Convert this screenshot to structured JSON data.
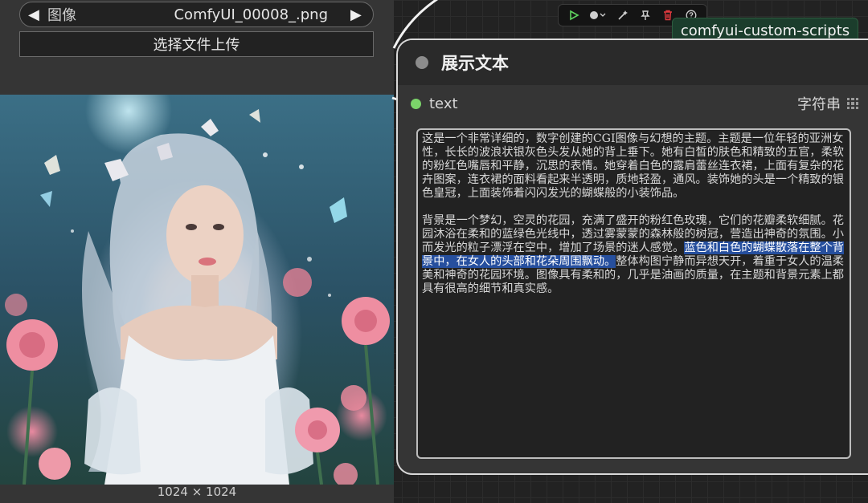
{
  "image_node": {
    "widget_label": "图像",
    "widget_value": "ComfyUI_00008_.png",
    "upload_label": "选择文件上传",
    "dimensions": "1024 × 1024"
  },
  "toolbar": {
    "icons": [
      "play-icon",
      "color-dot-icon",
      "wand-icon",
      "pin-icon",
      "trash-icon",
      "help-icon"
    ],
    "delete_color": "#e0393e",
    "play_color": "#5fd35f"
  },
  "tag": {
    "label": "comfyui-custom-scripts"
  },
  "text_node": {
    "title": "展示文本",
    "input_label": "text",
    "output_label": "字符串",
    "paragraph1": "这是一个非常详细的，数字创建的CGI图像与幻想的主题。主题是一位年轻的亚洲女性，长长的波浪状银灰色头发从她的背上垂下。她有白皙的肤色和精致的五官，柔软的粉红色嘴唇和平静，沉思的表情。她穿着白色的露肩蕾丝连衣裙，上面有复杂的花卉图案，连衣裙的面料看起来半透明，质地轻盈，通风。装饰她的头是一个精致的银色皇冠，上面装饰着闪闪发光的蝴蝶般的小装饰品。",
    "paragraph2_pre": "背景是一个梦幻，空灵的花园，充满了盛开的粉红色玫瑰，它们的花瓣柔软细腻。花园沐浴在柔和的蓝绿色光线中，透过雾蒙蒙的森林般的树冠，营造出神奇的氛围。小而发光的粒子漂浮在空中，增加了场景的迷人感觉。",
    "paragraph2_selected": "蓝色和白色的蝴蝶散落在整个背景中，在女人的头部和花朵周围飘动。",
    "paragraph2_post": "整体构图宁静而异想天开，着重于女人的温柔美和神奇的花园环境。图像具有柔和的，几乎是油画的质量，在主题和背景元素上都具有很高的细节和真实感。"
  }
}
